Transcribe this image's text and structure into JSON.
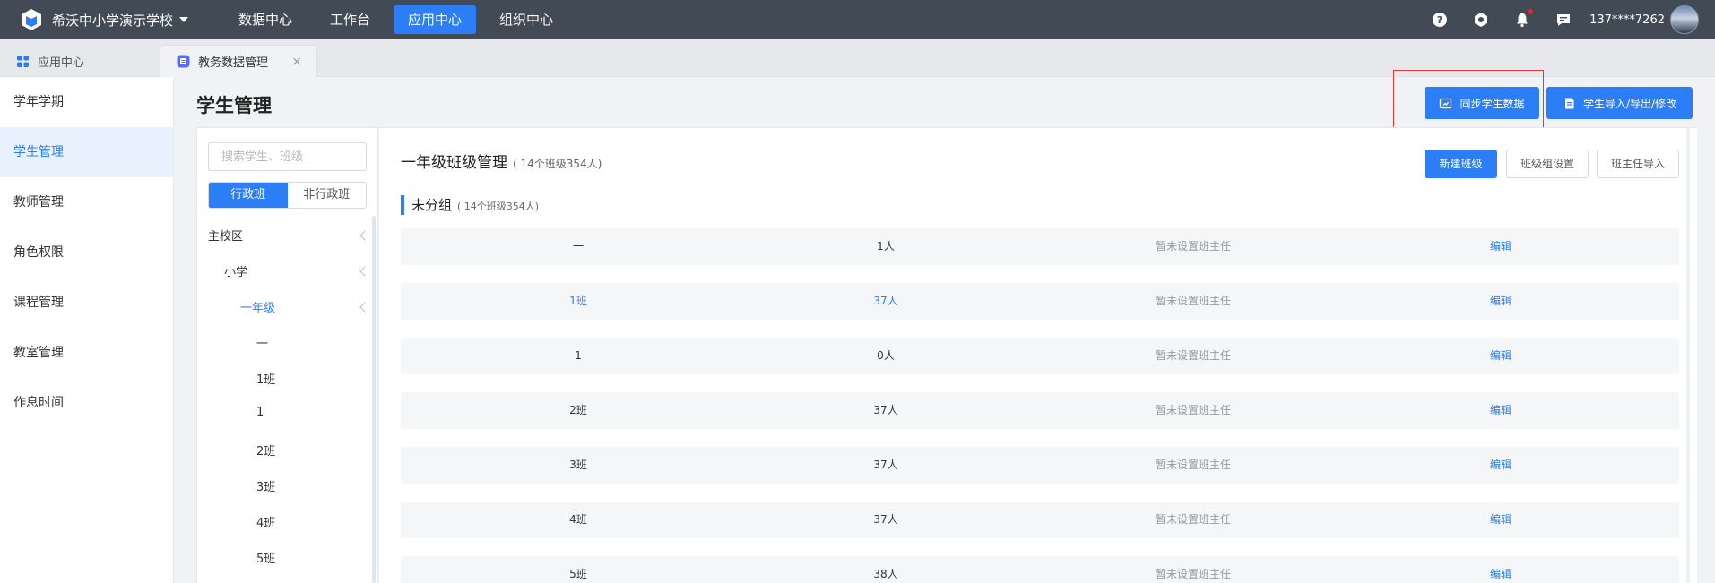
{
  "topbar": {
    "school_name": "希沃中小学演示学校",
    "nav": [
      {
        "label": "数据中心",
        "active": false
      },
      {
        "label": "工作台",
        "active": false
      },
      {
        "label": "应用中心",
        "active": true
      },
      {
        "label": "组织中心",
        "active": false
      }
    ],
    "username": "137****7262"
  },
  "tabs": {
    "home": "应用中心",
    "current": "教务数据管理",
    "close_glyph": "×"
  },
  "sidebar": {
    "items": [
      "学年学期",
      "学生管理",
      "教师管理",
      "角色权限",
      "课程管理",
      "教室管理",
      "作息时间"
    ],
    "active_index": 1
  },
  "page": {
    "title": "学生管理",
    "sync_button": "同步学生数据",
    "import_button": "学生导入/导出/修改"
  },
  "tree": {
    "search_placeholder": "搜索学生、班级",
    "segments": [
      "行政班",
      "非行政班"
    ],
    "nodes": [
      "主校区",
      "小学",
      "一年级",
      "一",
      "1班",
      "1",
      "2班",
      "3班",
      "4班",
      "5班"
    ]
  },
  "content": {
    "title": "一年级班级管理",
    "subtitle": "( 14个班级354人)",
    "new_button": "新建班级",
    "group_setting_button": "班级组设置",
    "head_teacher_import_button": "班主任导入",
    "group_title": "未分组",
    "group_subtitle": "( 14个班级354人)",
    "rows": [
      {
        "name": "一",
        "count": "1人",
        "teacher": "暂未设置班主任",
        "action": "编辑"
      },
      {
        "name": "1班",
        "count": "37人",
        "teacher": "暂未设置班主任",
        "action": "编辑"
      },
      {
        "name": "1",
        "count": "0人",
        "teacher": "暂未设置班主任",
        "action": "编辑"
      },
      {
        "name": "2班",
        "count": "37人",
        "teacher": "暂未设置班主任",
        "action": "编辑"
      },
      {
        "name": "3班",
        "count": "37人",
        "teacher": "暂未设置班主任",
        "action": "编辑"
      },
      {
        "name": "4班",
        "count": "37人",
        "teacher": "暂未设置班主任",
        "action": "编辑"
      },
      {
        "name": "5班",
        "count": "38人",
        "teacher": "暂未设置班主任",
        "action": "编辑"
      }
    ]
  },
  "colors": {
    "accent": "#2b7ef5",
    "topbar": "#414a55",
    "highlight": "#e23a3a"
  }
}
